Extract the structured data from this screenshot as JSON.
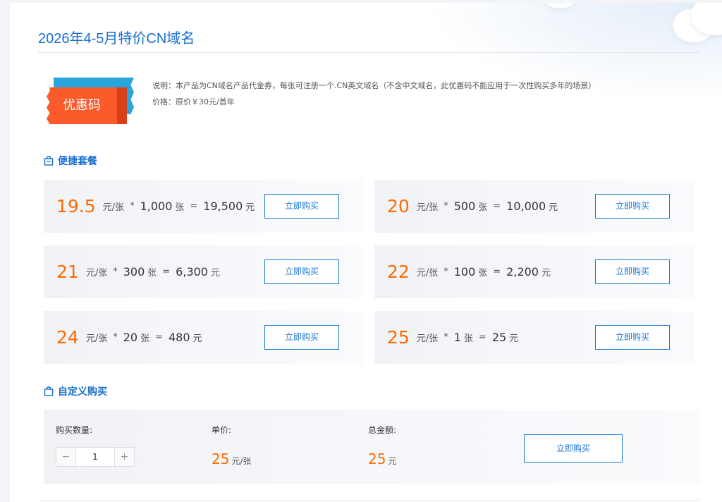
{
  "title": "2026年4-5月特价CN域名",
  "coupon": {
    "label": "优惠码"
  },
  "description": {
    "line1": "说明：本产品为CN域名产品代金券，每张可注册一个.CN英文域名（不含中文域名，此优惠码不能应用于一次性购买多年的场景）",
    "line2": "价格：原价￥30元/首年"
  },
  "packages_section": {
    "heading": "便捷套餐"
  },
  "packages": [
    {
      "price": "19.5",
      "unit": "元/张",
      "mult": "*",
      "qty": "1,000",
      "qty_unit": "张",
      "eq": "=",
      "total": "19,500",
      "total_unit": "元",
      "button": "立即购买"
    },
    {
      "price": "20",
      "unit": "元/张",
      "mult": "*",
      "qty": "500",
      "qty_unit": "张",
      "eq": "=",
      "total": "10,000",
      "total_unit": "元",
      "button": "立即购买"
    },
    {
      "price": "21",
      "unit": "元/张",
      "mult": "*",
      "qty": "300",
      "qty_unit": "张",
      "eq": "=",
      "total": "6,300",
      "total_unit": "元",
      "button": "立即购买"
    },
    {
      "price": "22",
      "unit": "元/张",
      "mult": "*",
      "qty": "100",
      "qty_unit": "张",
      "eq": "=",
      "total": "2,200",
      "total_unit": "元",
      "button": "立即购买"
    },
    {
      "price": "24",
      "unit": "元/张",
      "mult": "*",
      "qty": "20",
      "qty_unit": "张",
      "eq": "=",
      "total": "480",
      "total_unit": "元",
      "button": "立即购买"
    },
    {
      "price": "25",
      "unit": "元/张",
      "mult": "*",
      "qty": "1",
      "qty_unit": "张",
      "eq": "=",
      "total": "25",
      "total_unit": "元",
      "button": "立即购买"
    }
  ],
  "custom_section": {
    "heading": "自定义购买",
    "qty_label": "购买数量:",
    "qty_minus": "−",
    "qty_value": "1",
    "qty_plus": "+",
    "unit_price_label": "单价:",
    "unit_price": "25",
    "unit_price_unit": "元/张",
    "total_label": "总金额:",
    "total": "25",
    "total_unit": "元",
    "button": "立即购买"
  },
  "colors": {
    "accent": "#1a6ed2",
    "price": "#ff6a00",
    "coupon_front": "#fb5a2a",
    "coupon_back": "#2aa5dc"
  }
}
